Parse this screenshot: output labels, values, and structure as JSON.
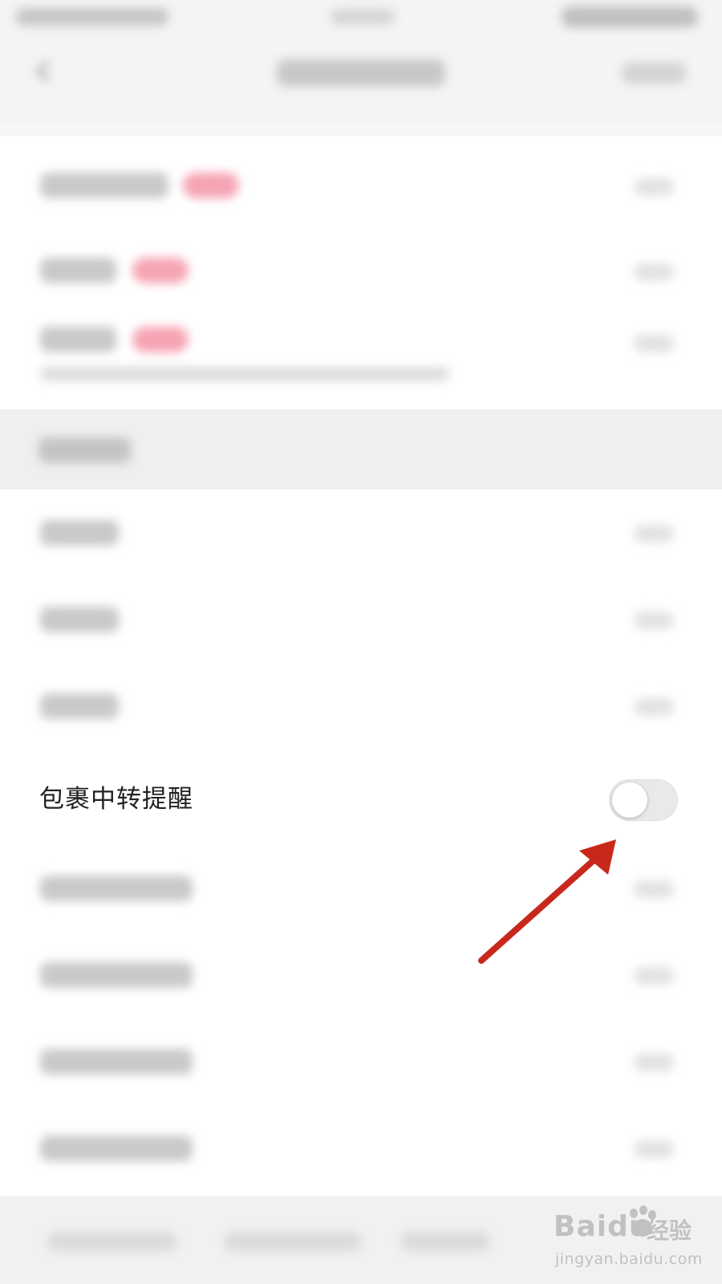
{
  "settings": {
    "parcel_transit_reminder": {
      "label": "包裹中转提醒",
      "toggle_state": "off"
    }
  },
  "annotation": {
    "arrow_color": "#c8281c"
  },
  "watermark": {
    "brand": "Baidu",
    "product": "经验",
    "url": "jingyan.baidu.com"
  },
  "colors": {
    "page_background": "#f6f6f7",
    "toggle_off_track": "#e9e9ea",
    "badge_pink": "#f6a4b3"
  }
}
